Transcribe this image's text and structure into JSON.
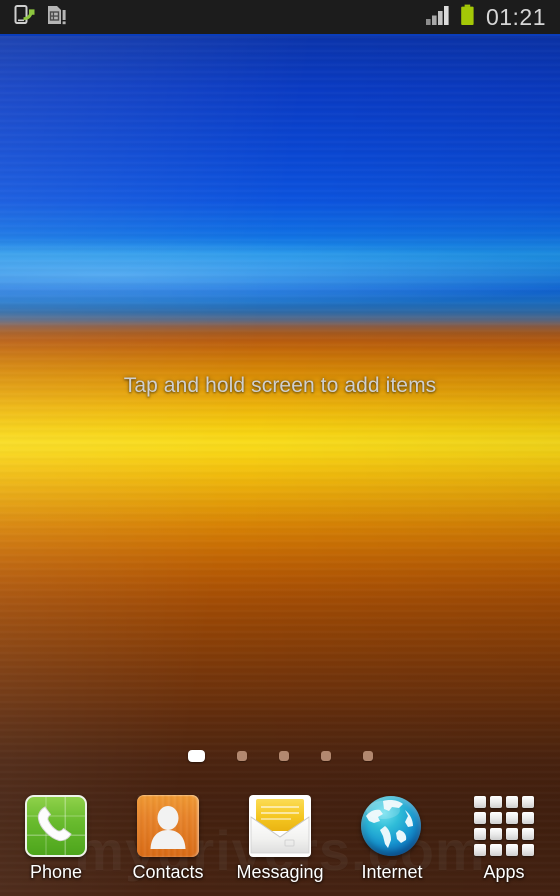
{
  "status_bar": {
    "left_icons": [
      {
        "name": "usb-transfer-icon",
        "label": "USB data transfer"
      },
      {
        "name": "sim-card-alert-icon",
        "label": "SIM card alert"
      }
    ],
    "right_icons": [
      {
        "name": "signal-bars-icon",
        "label": "Signal strength",
        "bars": 4
      },
      {
        "name": "battery-full-icon",
        "label": "Battery full",
        "color": "#a4c807"
      }
    ],
    "clock": "01:21"
  },
  "home": {
    "hint_text": "Tap and hold screen to add items",
    "watermark": "mydrivers.com",
    "page_indicator": {
      "total_pages": 5,
      "active_page": 1
    }
  },
  "dock": {
    "items": [
      {
        "icon": "phone-icon",
        "label": "Phone"
      },
      {
        "icon": "contacts-icon",
        "label": "Contacts"
      },
      {
        "icon": "messaging-icon",
        "label": "Messaging"
      },
      {
        "icon": "internet-icon",
        "label": "Internet"
      },
      {
        "icon": "apps-grid-icon",
        "label": "Apps"
      }
    ]
  },
  "colors": {
    "statusbar_bg": "#1c1c1c",
    "clock_text": "#d6d6d6",
    "battery_green": "#a4c807",
    "accent_blue": "#0a3dbb",
    "phone_green": "#69bb2e",
    "contacts_orange": "#e8842a",
    "messaging_yellow": "#f2cf3f",
    "internet_blue": "#1795cf"
  }
}
